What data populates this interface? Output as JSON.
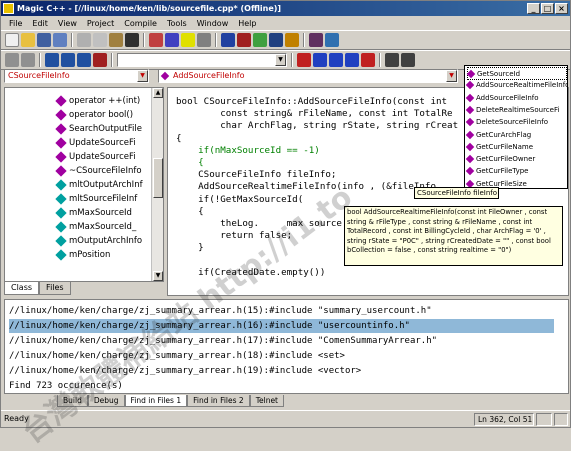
{
  "window": {
    "title": "Magic C++ - [//linux/home/ken/lib/sourcefile.cpp* (Offline)]"
  },
  "menu": [
    "File",
    "Edit",
    "View",
    "Project",
    "Compile",
    "Tools",
    "Window",
    "Help"
  ],
  "context": {
    "class_combo": "CSourceFileInfo",
    "method_combo": "AddSourceFileInfo"
  },
  "tree": {
    "items": [
      "operator ++(int)",
      "operator bool()",
      "SearchOutputFile",
      "UpdateSourceFi",
      "UpdateSourceFi",
      "~CSourceFileInfo",
      "mltOutputArchInf",
      "mltSourceFileInf",
      "mMaxSourceId",
      "mMaxSourceId_",
      "mOutputArchInfo",
      "mPosition"
    ],
    "item_colors": [
      "#a000a0",
      "#a000a0",
      "#a000a0",
      "#a000a0",
      "#a000a0",
      "#a000a0",
      "#00a0a0",
      "#00a0a0",
      "#00a0a0",
      "#00a0a0",
      "#00a0a0",
      "#00a0a0"
    ]
  },
  "left_tabs": [
    "Class",
    "Files"
  ],
  "code": [
    "bool CSourceFileInfo::AddSourceFileInfo(const int",
    "        const string& rFileName, const int TotalRe",
    "        char ArchFlag, string rState, string rCreat",
    "{",
    "    if(nMaxSourceId == -1)",
    "    {",
    "    CSourceFileInfo fileInfo;",
    "    AddSourceRealtimeFileInfo(info , (&fileInfo",
    "    if(!GetMaxSourceId(",
    "    {",
    "        theLog.     max source",
    "        return false;",
    "    }",
    "",
    "    if(CreatedDate.empty())"
  ],
  "member_list": {
    "items": [
      "GetSourceId",
      "AddSourceRealtimeFileInfo",
      "AddSourceFileInfo",
      "DeleteRealtimeSourceFi",
      "DeleteSourceFileInfo",
      "GetCurArchFlag",
      "GetCurFileName",
      "GetCurFileOwner",
      "GetCurFileType",
      "GetCurFileSize"
    ],
    "selected_index": 0
  },
  "tooltip_short": "CSourceFileInfo fileInfo",
  "tooltip_sig": "bool AddSourceRealtimeFileInfo(const int FileOwner , const string & rFileType , const string & rFileName , const int TotalRecord , const int BillingCycleId , char ArchFlag = '0' , string rState = \"P0C\" , string rCreatedDate = \"\" , const bool bCollection = false , const string realtime = \"0\")",
  "output": {
    "lines": [
      "//linux/home/ken/charge/zj_summary_arrear.h(15):#include \"summary_usercount.h\"",
      "//linux/home/ken/charge/zj_summary_arrear.h(16):#include \"usercountinfo.h\"",
      "//linux/home/ken/charge/zj_summary_arrear.h(17):#include \"ComenSummaryArrear.h\"",
      "//linux/home/ken/charge/zj_summary_arrear.h(18):#include <set>",
      "//linux/home/ken/charge/zj_summary_arrear.h(19):#include <vector>",
      "Find 723 occurence(s)"
    ],
    "selected_index": 1
  },
  "output_tabs": [
    "Build",
    "Debug",
    "Find in Files 1",
    "Find in Files 2",
    "Telnet"
  ],
  "status": {
    "text": "Ready",
    "position": "Ln 362, Col 51"
  },
  "watermark": "台灣軟體補給站 http://i1.to"
}
